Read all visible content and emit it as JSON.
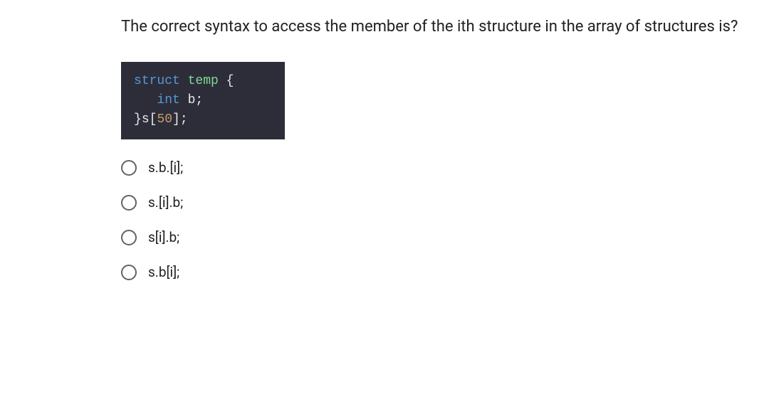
{
  "question": "The correct syntax to access the member of the ith structure in the array of structures is?",
  "code": {
    "line1": {
      "struct": "struct",
      "temp": " temp ",
      "brace": "{"
    },
    "line2": {
      "indent": "   ",
      "int": "int",
      "var": " b;"
    },
    "line3": {
      "brace1": "}",
      "var": "s",
      "bracket1": "[",
      "num": "50",
      "bracket2": "];"
    }
  },
  "options": [
    {
      "label": "s.b.[i];"
    },
    {
      "label": "s.[i].b;"
    },
    {
      "label": "s[i].b;"
    },
    {
      "label": "s.b[i];"
    }
  ]
}
